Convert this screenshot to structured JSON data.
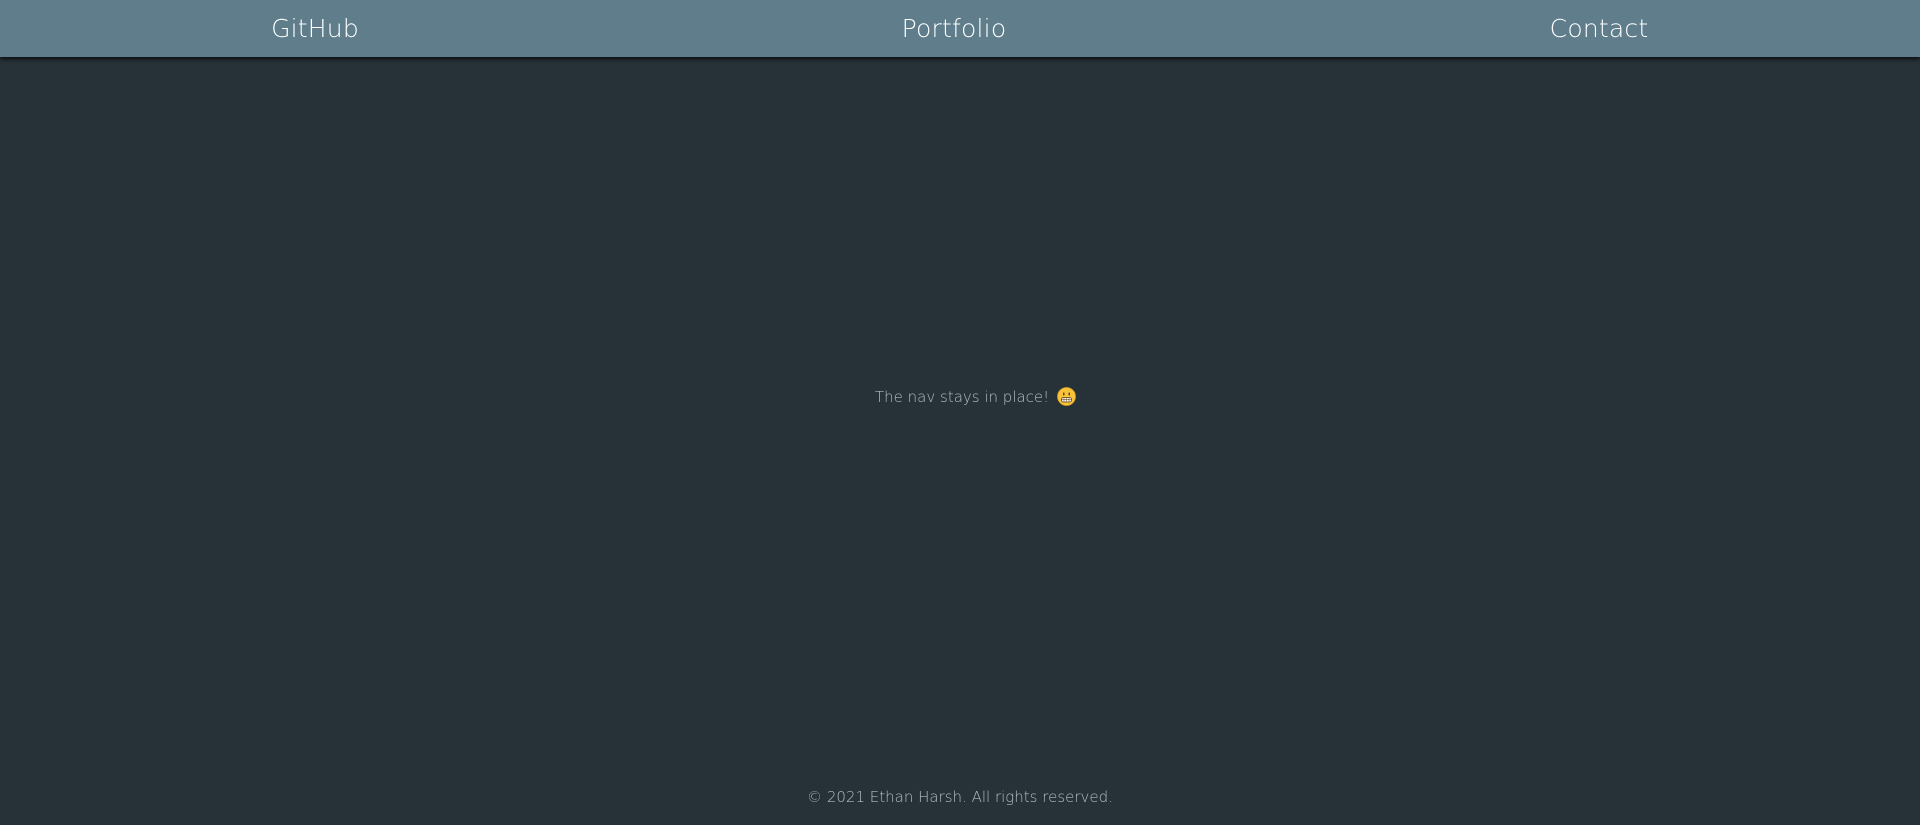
{
  "nav": {
    "github_label": "GitHub",
    "portfolio_label": "Portfolio",
    "contact_label": "Contact"
  },
  "main": {
    "message": "The nav stays in place!",
    "emoji_icon": "grimacing-face-icon"
  },
  "footer": {
    "copyright": "© 2021 Ethan Harsh. All rights reserved."
  },
  "colors": {
    "nav_background": "#607d8b",
    "page_background": "#263238",
    "nav_text": "#ffffff",
    "body_text": "#b0bec5"
  }
}
